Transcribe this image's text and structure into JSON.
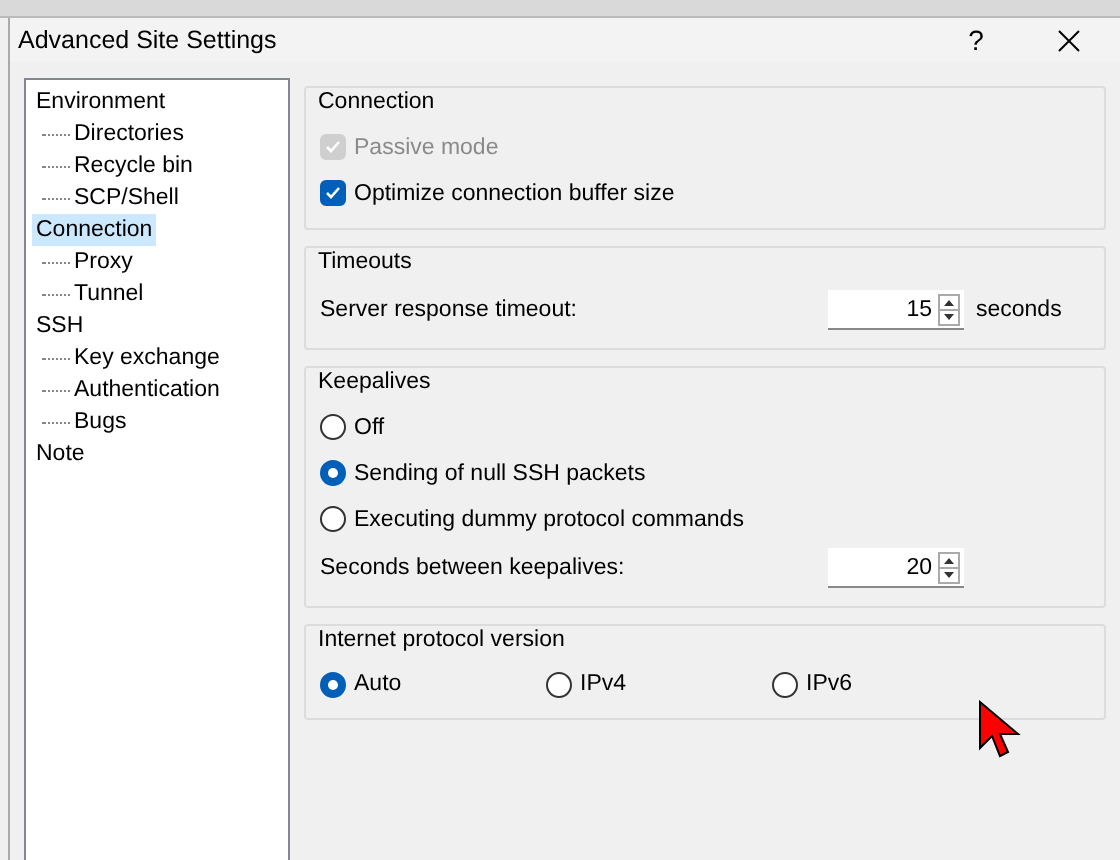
{
  "window": {
    "title": "Advanced Site Settings",
    "help": "?"
  },
  "tree": [
    {
      "label": "Environment",
      "selected": false,
      "children": [
        {
          "label": "Directories",
          "selected": false
        },
        {
          "label": "Recycle bin",
          "selected": false
        },
        {
          "label": "SCP/Shell",
          "selected": false
        }
      ]
    },
    {
      "label": "Connection",
      "selected": true,
      "children": [
        {
          "label": "Proxy",
          "selected": false
        },
        {
          "label": "Tunnel",
          "selected": false
        }
      ]
    },
    {
      "label": "SSH",
      "selected": false,
      "children": [
        {
          "label": "Key exchange",
          "selected": false
        },
        {
          "label": "Authentication",
          "selected": false
        },
        {
          "label": "Bugs",
          "selected": false
        }
      ]
    },
    {
      "label": "Note",
      "selected": false
    }
  ],
  "groups": [
    {
      "title": "Connection",
      "rows": [
        {
          "kind": "checkbox",
          "label": "Passive mode",
          "checked": true,
          "disabled": true
        },
        {
          "kind": "checkbox",
          "label": "Optimize connection buffer size",
          "checked": true,
          "disabled": false
        }
      ]
    },
    {
      "title": "Timeouts",
      "rows": [
        {
          "kind": "spinner",
          "label": "Server response timeout:",
          "value": "15",
          "unit": "seconds"
        }
      ]
    },
    {
      "title": "Keepalives",
      "rows": [
        {
          "kind": "radio",
          "label": "Off",
          "selected": false
        },
        {
          "kind": "radio",
          "label": "Sending of null SSH packets",
          "selected": true
        },
        {
          "kind": "radio",
          "label": "Executing dummy protocol commands",
          "selected": false
        },
        {
          "kind": "spinner",
          "label": "Seconds between keepalives:",
          "value": "20"
        }
      ]
    },
    {
      "title": "Internet protocol version",
      "rows": [
        {
          "kind": "radio-row",
          "options": [
            {
              "label": "Auto",
              "selected": true
            },
            {
              "label": "IPv4",
              "selected": false
            },
            {
              "label": "IPv6",
              "selected": false
            }
          ]
        }
      ]
    }
  ]
}
